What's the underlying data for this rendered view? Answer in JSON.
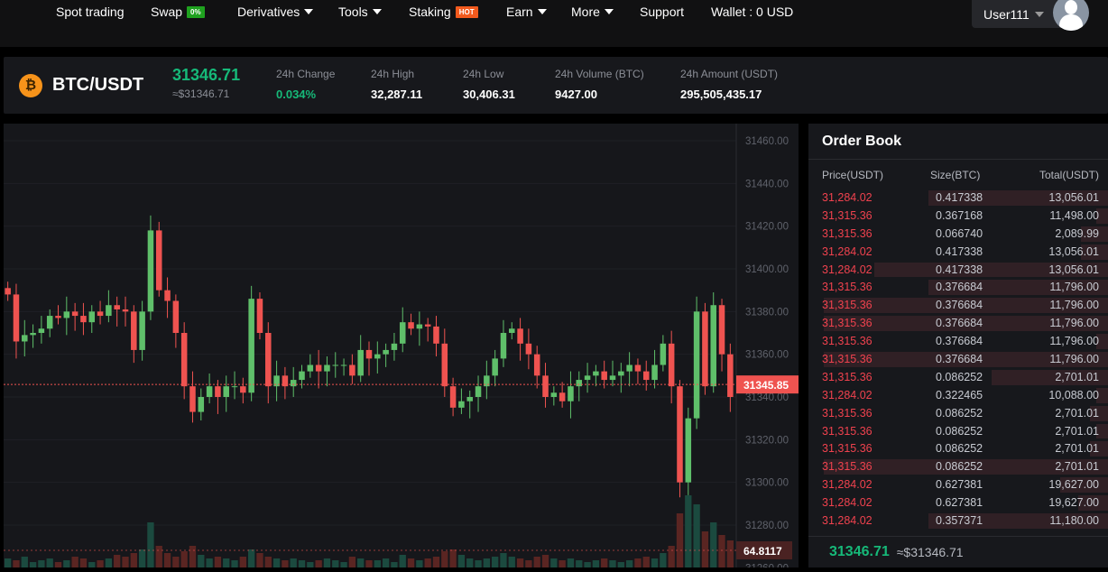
{
  "nav": {
    "items": [
      {
        "label": "Spot trading"
      },
      {
        "label": "Swap",
        "badge": "0%",
        "badge_color": "#1fa21f"
      },
      {
        "label": "Derivatives",
        "dropdown": true
      },
      {
        "label": "Tools",
        "dropdown": true
      },
      {
        "label": "Staking",
        "badge": "HOT",
        "badge_color": "#f25a1d"
      },
      {
        "label": "Earn",
        "dropdown": true
      },
      {
        "label": "More",
        "dropdown": true
      },
      {
        "label": "Support"
      },
      {
        "label": "Wallet : 0 USD"
      }
    ],
    "user": "User111"
  },
  "ticker": {
    "pair": "BTC/USDT",
    "coin_icon": "bitcoin-icon",
    "price": "31346.71",
    "price_usd": "≈$31346.71",
    "stats": [
      {
        "label": "24h Change",
        "value": "0.034%",
        "color": "#16b979"
      },
      {
        "label": "24h High",
        "value": "32,287.11"
      },
      {
        "label": "24h Low",
        "value": "30,406.31"
      },
      {
        "label": "24h Volume (BTC)",
        "value": "9427.00"
      },
      {
        "label": "24h Amount (USDT)",
        "value": "295,505,435.17"
      }
    ]
  },
  "colors": {
    "up": "#5fbf6a",
    "down": "#ef5350",
    "green_text": "#16b979",
    "red_text": "#f0424e"
  },
  "chart_data": {
    "type": "candlestick",
    "ylim": [
      31260,
      31460
    ],
    "y_ticks": [
      "31460.00",
      "31440.00",
      "31420.00",
      "31400.00",
      "31380.00",
      "31360.00",
      "31340.00",
      "31320.00",
      "31300.00",
      "31280.00",
      "31260.00"
    ],
    "last_price_label": "31345.85",
    "volume_label": "64.8117",
    "closes": [
      31388,
      31366,
      31369,
      31370,
      31372,
      31378,
      31377,
      31380,
      31378,
      31375,
      31380,
      31378,
      31383,
      31381,
      31380,
      31362,
      31380,
      31418,
      31390,
      31385,
      31370,
      31345,
      31333,
      31340,
      31345,
      31340,
      31345,
      31345,
      31342,
      31386,
      31370,
      31345,
      31350,
      31345,
      31348,
      31352,
      31355,
      31352,
      31355,
      31355,
      31355,
      31350,
      31362,
      31358,
      31360,
      31362,
      31365,
      31375,
      31372,
      31374,
      31373,
      31365,
      31345,
      31335,
      31338,
      31340,
      31345,
      31350,
      31358,
      31370,
      31372,
      31365,
      31360,
      31350,
      31340,
      31342,
      31338,
      31345,
      31348,
      31350,
      31352,
      31348,
      31350,
      31352,
      31355,
      31352,
      31348,
      31355,
      31365,
      31345,
      31300,
      31330,
      31380,
      31345,
      31383,
      31360,
      31340
    ],
    "volumes": [
      5,
      4,
      6,
      3,
      4,
      5,
      3,
      4,
      6,
      5,
      3,
      4,
      5,
      7,
      6,
      8,
      10,
      25,
      12,
      8,
      6,
      9,
      12,
      7,
      5,
      6,
      5,
      4,
      6,
      10,
      8,
      6,
      5,
      4,
      5,
      4,
      3,
      4,
      5,
      4,
      3,
      6,
      5,
      4,
      4,
      5,
      3,
      7,
      5,
      4,
      5,
      6,
      9,
      10,
      7,
      5,
      4,
      5,
      6,
      8,
      6,
      5,
      4,
      6,
      7,
      5,
      4,
      5,
      4,
      3,
      4,
      5,
      4,
      3,
      4,
      5,
      6,
      5,
      8,
      12,
      30,
      40,
      35,
      20,
      25,
      18,
      15
    ]
  },
  "order_book": {
    "title": "Order Book",
    "headers": [
      "Price(USDT)",
      "Size(BTC)",
      "Total(USDT)"
    ],
    "rows": [
      {
        "price": "31,284.02",
        "size": "0.417338",
        "total": "13,056.01",
        "depth": 0.6
      },
      {
        "price": "31,315.36",
        "size": "0.367168",
        "total": "11,498.00",
        "depth": 0.04
      },
      {
        "price": "31,315.36",
        "size": "0.066740",
        "total": "2,089.99",
        "depth": 0.09
      },
      {
        "price": "31,284.02",
        "size": "0.417338",
        "total": "13,056.01",
        "depth": 0.09
      },
      {
        "price": "31,284.02",
        "size": "0.417338",
        "total": "13,056.01",
        "depth": 0.78
      },
      {
        "price": "31,315.36",
        "size": "0.376684",
        "total": "11,796.00",
        "depth": 0.6
      },
      {
        "price": "31,315.36",
        "size": "0.376684",
        "total": "11,796.00",
        "depth": 0.95
      },
      {
        "price": "31,315.36",
        "size": "0.376684",
        "total": "11,796.00",
        "depth": 0.95
      },
      {
        "price": "31,315.36",
        "size": "0.376684",
        "total": "11,796.00",
        "depth": 0.04
      },
      {
        "price": "31,315.36",
        "size": "0.376684",
        "total": "11,796.00",
        "depth": 0.95
      },
      {
        "price": "31,315.36",
        "size": "0.086252",
        "total": "2,701.01",
        "depth": 0.39
      },
      {
        "price": "31,284.02",
        "size": "0.322465",
        "total": "10,088.00",
        "depth": 0.04
      },
      {
        "price": "31,315.36",
        "size": "0.086252",
        "total": "2,701.01",
        "depth": 0.06
      },
      {
        "price": "31,315.36",
        "size": "0.086252",
        "total": "2,701.01",
        "depth": 0.04
      },
      {
        "price": "31,315.36",
        "size": "0.086252",
        "total": "2,701.01",
        "depth": 0.06
      },
      {
        "price": "31,315.36",
        "size": "0.086252",
        "total": "2,701.01",
        "depth": 0.95
      },
      {
        "price": "31,284.02",
        "size": "0.627381",
        "total": "19,627.00",
        "depth": 0.16
      },
      {
        "price": "31,284.02",
        "size": "0.627381",
        "total": "19,627.00",
        "depth": 0.1
      },
      {
        "price": "31,284.02",
        "size": "0.357371",
        "total": "11,180.00",
        "depth": 0.6
      }
    ],
    "last_price": "31346.71",
    "last_price_usd": "≈$31346.71"
  }
}
